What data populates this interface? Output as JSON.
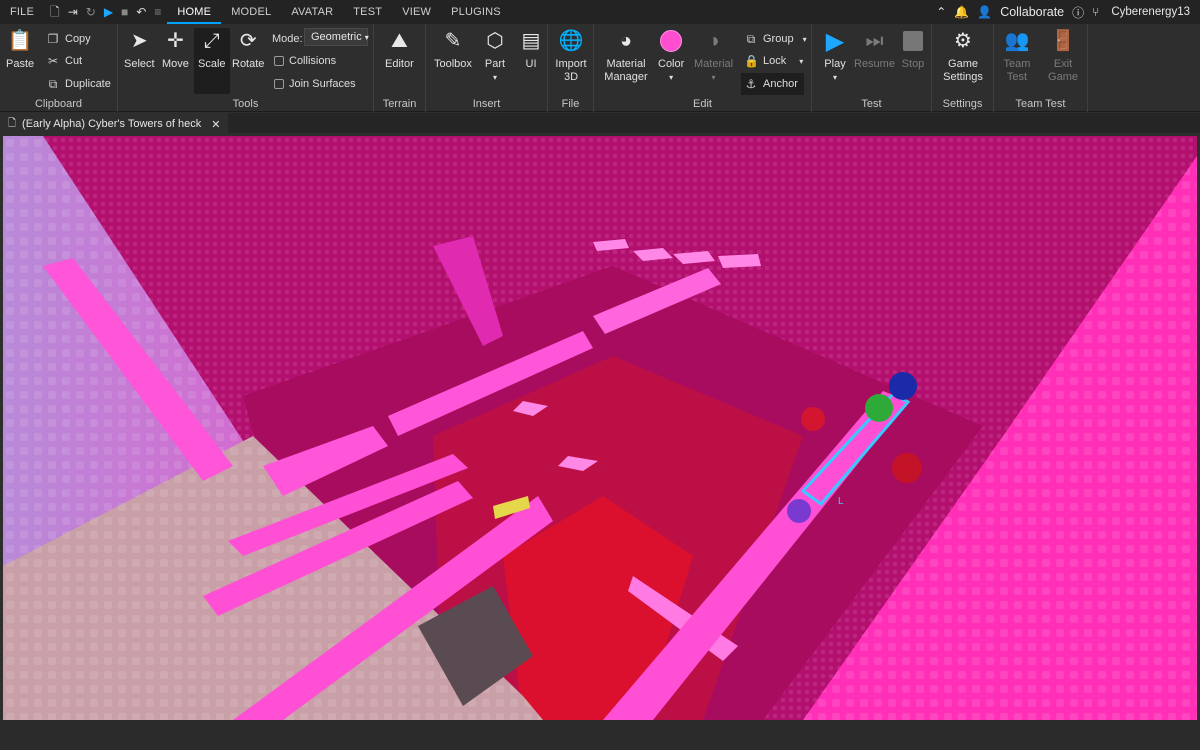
{
  "menubar": {
    "file": "FILE",
    "tabs": [
      "HOME",
      "MODEL",
      "AVATAR",
      "TEST",
      "VIEW",
      "PLUGINS"
    ],
    "active_tab": "HOME",
    "collaborate": "Collaborate",
    "username": "Cyberenergy13"
  },
  "ribbon": {
    "clipboard": {
      "label": "Clipboard",
      "paste": "Paste",
      "copy": "Copy",
      "cut": "Cut",
      "duplicate": "Duplicate"
    },
    "tools": {
      "label": "Tools",
      "select": "Select",
      "move": "Move",
      "scale": "Scale",
      "rotate": "Rotate",
      "mode_label": "Mode:",
      "mode_value": "Geometric",
      "collisions": "Collisions",
      "join_surfaces": "Join Surfaces"
    },
    "terrain": {
      "label": "Terrain",
      "editor": "Editor"
    },
    "insert": {
      "label": "Insert",
      "toolbox": "Toolbox",
      "part": "Part",
      "ui": "UI"
    },
    "file": {
      "label": "File",
      "import_3d": "Import 3D"
    },
    "edit": {
      "label": "Edit",
      "material_manager": "Material Manager",
      "color": "Color",
      "material": "Material",
      "group": "Group",
      "lock": "Lock",
      "anchor": "Anchor",
      "color_value": "#ff4fd0"
    },
    "test": {
      "label": "Test",
      "play": "Play",
      "resume": "Resume",
      "stop": "Stop"
    },
    "settings": {
      "label": "Settings",
      "game_settings": "Game Settings"
    },
    "team_test": {
      "label": "Team Test",
      "team_test": "Team Test",
      "exit_game": "Exit Game"
    }
  },
  "document_tab": {
    "title": "(Early Alpha) Cyber's Towers of heck"
  },
  "viewport": {
    "selection_marker": "L"
  },
  "colors": {
    "accent": "#00a2ff",
    "scene_magenta": "#c0127a",
    "scene_pink": "#ff3fd8",
    "scene_red": "#e0102a"
  }
}
